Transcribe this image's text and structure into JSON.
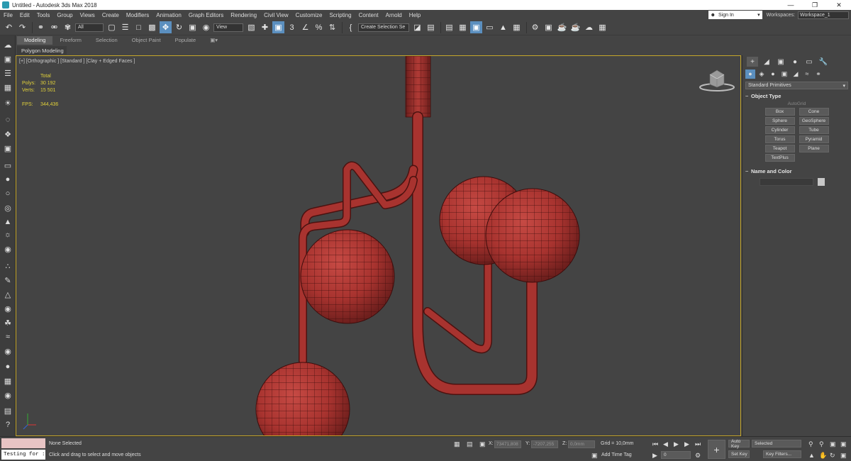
{
  "window": {
    "title": "Untitled - Autodesk 3ds Max 2018",
    "min": "—",
    "max": "❐",
    "close": "✕"
  },
  "menu": [
    "File",
    "Edit",
    "Tools",
    "Group",
    "Views",
    "Create",
    "Modifiers",
    "Animation",
    "Graph Editors",
    "Rendering",
    "Civil View",
    "Customize",
    "Scripting",
    "Content",
    "Arnold",
    "Help"
  ],
  "account": {
    "sign_in": "Sign In",
    "workspaces_label": "Workspaces:",
    "workspace": "Workspace_1"
  },
  "toolbar": {
    "filter": "All",
    "ref_coord": "View",
    "snap_3": "3",
    "percent": "%",
    "selection_set": "Create Selection Se"
  },
  "ribbon": {
    "tabs": [
      "Modeling",
      "Freeform",
      "Selection",
      "Object Paint",
      "Populate"
    ],
    "sub": "Polygon Modeling"
  },
  "viewport": {
    "label": "[+] [Orthographic ] [Standard ] [Clay + Edged Faces ]",
    "stats_total": "Total",
    "polys_label": "Polys:",
    "polys_value": "30 192",
    "verts_label": "Verts:",
    "verts_value": "15 501",
    "fps_label": "FPS:",
    "fps_value": "344,436",
    "model_color": "#a8332f",
    "border_color": "#c5a62a"
  },
  "command_panel": {
    "primitives": "Standard Primitives",
    "object_type": "Object Type",
    "autogrid": "AutoGrid",
    "buttons": [
      "Box",
      "Cone",
      "Sphere",
      "GeoSphere",
      "Cylinder",
      "Tube",
      "Torus",
      "Pyramid",
      "Teapot",
      "Plane",
      "TextPlus"
    ],
    "name_and_color": "Name and Color"
  },
  "status": {
    "listener": "Testing for :",
    "selection": "None Selected",
    "prompt": "Click and drag to select and move objects",
    "x_label": "X:",
    "x_value": "73471,808",
    "y_label": "Y:",
    "y_value": "-7207,255",
    "z_label": "Z:",
    "z_value": "0,0mm",
    "grid": "Grid = 10,0mm",
    "add_time_tag": "Add Time Tag",
    "frame": "0",
    "auto_key": "Auto Key",
    "set_key": "Set Key",
    "selected": "Selected",
    "key_filters": "Key Filters..."
  }
}
